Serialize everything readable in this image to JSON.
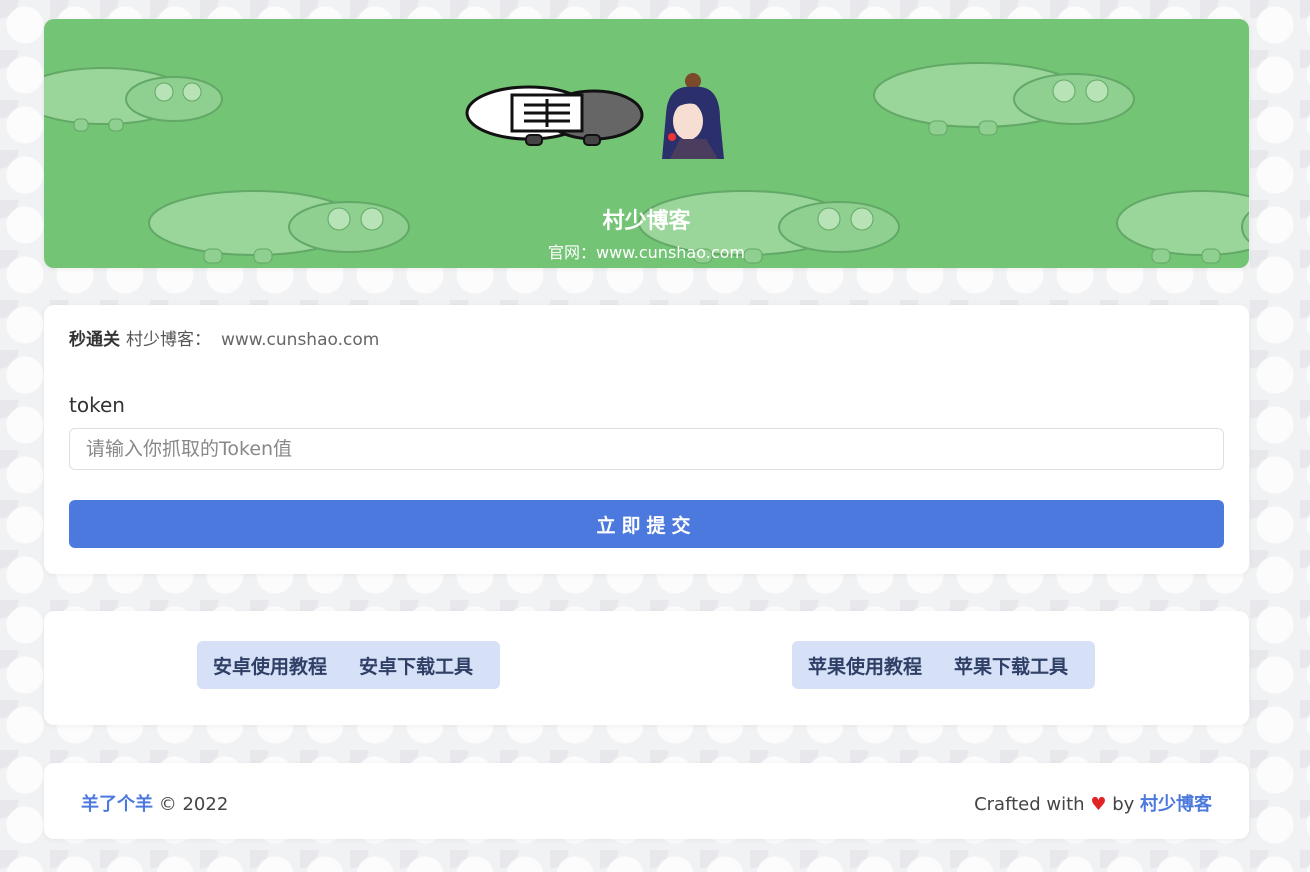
{
  "header": {
    "title": "村少博客",
    "subtitle": "官网：www.cunshao.com"
  },
  "form": {
    "brand": "秒通关",
    "blog_label": "村少博客：",
    "blog_url": "www.cunshao.com",
    "token_label": "token",
    "token_placeholder": "请输入你抓取的Token值",
    "token_value": "",
    "submit_label": "立即提交"
  },
  "links": {
    "android_tutorial": "安卓使用教程",
    "android_download": "安卓下载工具",
    "apple_tutorial": "苹果使用教程",
    "apple_download": "苹果下载工具"
  },
  "footer": {
    "site_name": "羊了个羊",
    "copyright": "© 2022",
    "crafted_with": "Crafted with",
    "by": "by",
    "author": "村少博客"
  },
  "colors": {
    "banner_bg": "#74c476",
    "primary": "#4c79dd",
    "link_button_bg": "#d6e0f7",
    "heart": "#e02424"
  }
}
